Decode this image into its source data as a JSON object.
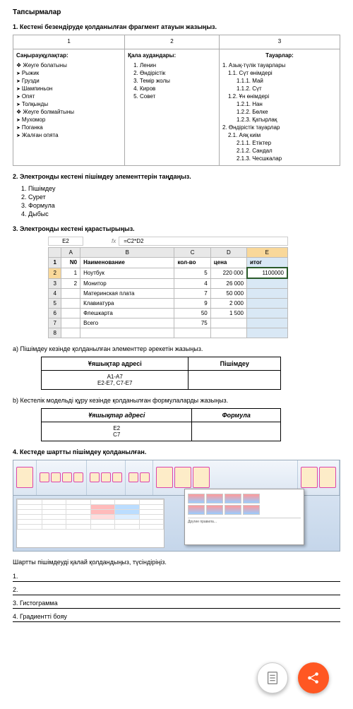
{
  "title": "Тапсырмалар",
  "task1": {
    "heading": "1. Кестені безендіруде қолданылған фрагмент атауын жазыңыз.",
    "cols": [
      "1",
      "2",
      "3"
    ],
    "col1": {
      "head": "Саңырауқұлақтар:",
      "g1": "Жеуге болатыны",
      "g1items": [
        "Рыжик",
        "Грузди",
        "Шампиньон",
        "Опят",
        "Толқынды"
      ],
      "g2": "Жеуге болмайтыны",
      "g2items": [
        "Мухомор",
        "Поганка",
        "Жалған опята"
      ]
    },
    "col2": {
      "head": "Қала аудандары:",
      "items": [
        "1.  Ленин",
        "2.  Өндірістік",
        "3.  Темір жолы",
        "4.  Киров",
        "5.  Совет"
      ]
    },
    "col3": {
      "head": "Тауарлар:",
      "l1": "1.  Азық-түлік тауарлары",
      "l11": "1.1. Сүт өнімдері",
      "l111": "1.1.1.  Май",
      "l112": "1.1.2.  Сүт",
      "l12": "1.2. Ұн өнімдері",
      "l121": "1.2.1.  Нан",
      "l122": "1.2.2.  Бөлке",
      "l123": "1.2.3.  Қатырлақ",
      "l2": "2.  Өндірістік тауарлар",
      "l21": "2.1. Аяқ киім",
      "l211": "2.1.1.  Етіктер",
      "l212": "2.1.2.  Сандал",
      "l213": "2.1.3.  Чесшкалар"
    }
  },
  "task2": {
    "heading": "2. Электронды кестені пішімдеу элементтерін таңдаңыз.",
    "items": [
      "1. Пішімдеу",
      "2. Сурет",
      "3. Формула",
      "4. Дыбыс"
    ]
  },
  "task3": {
    "heading": "3. Электронды кестені қарастырыңыз.",
    "cellref": "E2",
    "formula": "=C2*D2",
    "headers": [
      "A",
      "B",
      "C",
      "D",
      "E"
    ],
    "row1": {
      "a": "N0",
      "b": "Наименование",
      "c": "кол-во",
      "d": "цена",
      "e": "итог"
    },
    "rows": [
      {
        "n": "2",
        "a": "1",
        "b": "Ноутбук",
        "c": "5",
        "d": "220 000",
        "e": "1100000"
      },
      {
        "n": "3",
        "a": "2",
        "b": "Монитор",
        "c": "4",
        "d": "26 000",
        "e": ""
      },
      {
        "n": "4",
        "a": "",
        "b": "Материнская плата",
        "c": "7",
        "d": "50 000",
        "e": ""
      },
      {
        "n": "5",
        "a": "",
        "b": "Клавиатура",
        "c": "9",
        "d": "2 000",
        "e": ""
      },
      {
        "n": "6",
        "a": "",
        "b": "Флешкарта",
        "c": "50",
        "d": "1 500",
        "e": ""
      },
      {
        "n": "7",
        "a": "",
        "b": "Всего",
        "c": "75",
        "d": "",
        "e": ""
      }
    ],
    "subA": "а) Пішімдеу кезінде қолданылған элементтер әрекетін жазыңыз.",
    "tableA": {
      "h1": "Ұяшықтар адресі",
      "h2": "Пішімдеу",
      "r1": "А1-А7",
      "r2": "Е2-Е7, С7-Е7"
    },
    "subB": "b) Кестелік модельді құру кезінде қолданылған формулаларды жазыңыз.",
    "tableB": {
      "h1": "Ұяшықтар адресі",
      "h2": "Формула",
      "r1": "Е2",
      "r2": "С7"
    }
  },
  "task4": {
    "heading": "4. Кестеде шартты пішімдеу қолданылған.",
    "footer": "Шартты пішімдеуді қалай қолдандыңыз, түсіндіріңіз.",
    "lines": [
      "1.",
      "2.",
      "3. Гистограмма",
      "4. Градиентті бояу"
    ]
  },
  "icons": {
    "doc": "≡",
    "share": "⋮"
  }
}
